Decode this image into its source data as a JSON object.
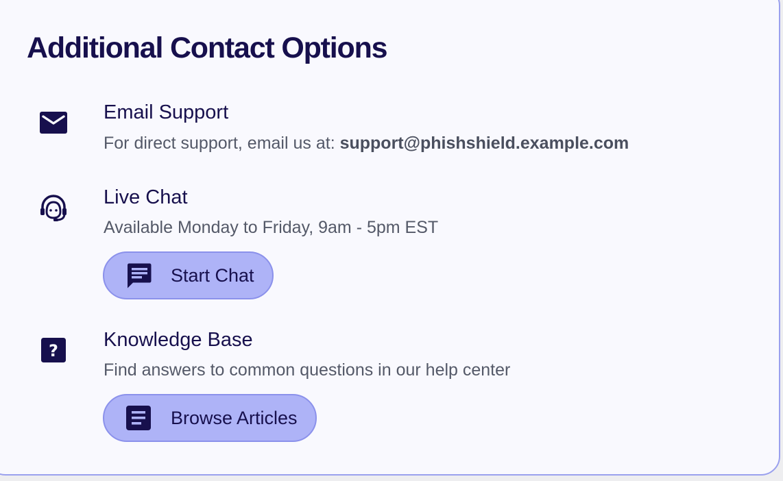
{
  "page": {
    "title": "Additional Contact Options"
  },
  "colors": {
    "ink": "#17104d",
    "muted_text": "#545968",
    "card_background": "#f9f9fe",
    "card_border": "#9aa0ee",
    "button_background": "#aeb3f7",
    "button_border": "#8b91eb"
  },
  "email": {
    "icon": "envelope-icon",
    "title": "Email Support",
    "description_prefix": "For direct support, email us at: ",
    "address": "support@phishshield.example.com"
  },
  "chat": {
    "icon": "support-agent-icon",
    "title": "Live Chat",
    "description": "Available Monday to Friday, 9am - 5pm EST",
    "button_icon": "chat-bubble-icon",
    "button_label": "Start Chat"
  },
  "kb": {
    "icon": "help-icon",
    "title": "Knowledge Base",
    "description": "Find answers to common questions in our help center",
    "button_icon": "article-icon",
    "button_label": "Browse Articles"
  }
}
